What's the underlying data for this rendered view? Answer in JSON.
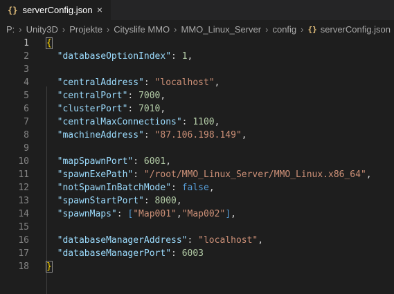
{
  "tab": {
    "title": "serverConfig.json",
    "icon": "{}",
    "close": "×"
  },
  "breadcrumb": [
    "P:",
    "Unity3D",
    "Projekte",
    "Cityslife MMO",
    "MMO_Linux_Server",
    "config",
    "serverConfig.json"
  ],
  "breadcrumb_sep": "›",
  "breadcrumb_icon": "{}",
  "editor": {
    "lines": [
      {
        "n": "1",
        "active": true,
        "tokens": [
          {
            "t": "brace",
            "v": "{"
          }
        ]
      },
      {
        "n": "2",
        "tokens": [
          {
            "t": "p",
            "v": "  "
          },
          {
            "t": "k",
            "v": "\"databaseOptionIndex\""
          },
          {
            "t": "p",
            "v": ": "
          },
          {
            "t": "n",
            "v": "1"
          },
          {
            "t": "p",
            "v": ","
          }
        ]
      },
      {
        "n": "3",
        "tokens": []
      },
      {
        "n": "4",
        "tokens": [
          {
            "t": "p",
            "v": "  "
          },
          {
            "t": "k",
            "v": "\"centralAddress\""
          },
          {
            "t": "p",
            "v": ": "
          },
          {
            "t": "s",
            "v": "\"localhost\""
          },
          {
            "t": "p",
            "v": ","
          }
        ]
      },
      {
        "n": "5",
        "tokens": [
          {
            "t": "p",
            "v": "  "
          },
          {
            "t": "k",
            "v": "\"centralPort\""
          },
          {
            "t": "p",
            "v": ": "
          },
          {
            "t": "n",
            "v": "7000"
          },
          {
            "t": "p",
            "v": ","
          }
        ]
      },
      {
        "n": "6",
        "tokens": [
          {
            "t": "p",
            "v": "  "
          },
          {
            "t": "k",
            "v": "\"clusterPort\""
          },
          {
            "t": "p",
            "v": ": "
          },
          {
            "t": "n",
            "v": "7010"
          },
          {
            "t": "p",
            "v": ","
          }
        ]
      },
      {
        "n": "7",
        "tokens": [
          {
            "t": "p",
            "v": "  "
          },
          {
            "t": "k",
            "v": "\"centralMaxConnections\""
          },
          {
            "t": "p",
            "v": ": "
          },
          {
            "t": "n",
            "v": "1100"
          },
          {
            "t": "p",
            "v": ","
          }
        ]
      },
      {
        "n": "8",
        "tokens": [
          {
            "t": "p",
            "v": "  "
          },
          {
            "t": "k",
            "v": "\"machineAddress\""
          },
          {
            "t": "p",
            "v": ": "
          },
          {
            "t": "s",
            "v": "\"87.106.198.149\""
          },
          {
            "t": "p",
            "v": ","
          }
        ]
      },
      {
        "n": "9",
        "tokens": []
      },
      {
        "n": "10",
        "tokens": [
          {
            "t": "p",
            "v": "  "
          },
          {
            "t": "k",
            "v": "\"mapSpawnPort\""
          },
          {
            "t": "p",
            "v": ": "
          },
          {
            "t": "n",
            "v": "6001"
          },
          {
            "t": "p",
            "v": ","
          }
        ]
      },
      {
        "n": "11",
        "tokens": [
          {
            "t": "p",
            "v": "  "
          },
          {
            "t": "k",
            "v": "\"spawnExePath\""
          },
          {
            "t": "p",
            "v": ": "
          },
          {
            "t": "s",
            "v": "\"/root/MMO_Linux_Server/MMO_Linux.x86_64\""
          },
          {
            "t": "p",
            "v": ","
          }
        ]
      },
      {
        "n": "12",
        "tokens": [
          {
            "t": "p",
            "v": "  "
          },
          {
            "t": "k",
            "v": "\"notSpawnInBatchMode\""
          },
          {
            "t": "p",
            "v": ": "
          },
          {
            "t": "b",
            "v": "false"
          },
          {
            "t": "p",
            "v": ","
          }
        ]
      },
      {
        "n": "13",
        "tokens": [
          {
            "t": "p",
            "v": "  "
          },
          {
            "t": "k",
            "v": "\"spawnStartPort\""
          },
          {
            "t": "p",
            "v": ": "
          },
          {
            "t": "n",
            "v": "8000"
          },
          {
            "t": "p",
            "v": ","
          }
        ]
      },
      {
        "n": "14",
        "tokens": [
          {
            "t": "p",
            "v": "  "
          },
          {
            "t": "k",
            "v": "\"spawnMaps\""
          },
          {
            "t": "p",
            "v": ": "
          },
          {
            "t": "b",
            "v": "["
          },
          {
            "t": "s",
            "v": "\"Map001\""
          },
          {
            "t": "p",
            "v": ","
          },
          {
            "t": "s",
            "v": "\"Map002\""
          },
          {
            "t": "b",
            "v": "]"
          },
          {
            "t": "p",
            "v": ","
          }
        ]
      },
      {
        "n": "15",
        "tokens": []
      },
      {
        "n": "16",
        "tokens": [
          {
            "t": "p",
            "v": "  "
          },
          {
            "t": "k",
            "v": "\"databaseManagerAddress\""
          },
          {
            "t": "p",
            "v": ": "
          },
          {
            "t": "s",
            "v": "\"localhost\""
          },
          {
            "t": "p",
            "v": ","
          }
        ]
      },
      {
        "n": "17",
        "tokens": [
          {
            "t": "p",
            "v": "  "
          },
          {
            "t": "k",
            "v": "\"databaseManagerPort\""
          },
          {
            "t": "p",
            "v": ": "
          },
          {
            "t": "n",
            "v": "6003"
          }
        ]
      },
      {
        "n": "18",
        "tokens": [
          {
            "t": "brace",
            "v": "}"
          }
        ]
      }
    ]
  },
  "colors": {
    "background": "#1e1e1e",
    "tabbar": "#252526",
    "key": "#9cdcfe",
    "string": "#ce9178",
    "number": "#b5cea8",
    "keyword": "#569cd6",
    "brace": "#ffd700",
    "line_number": "#858585"
  }
}
